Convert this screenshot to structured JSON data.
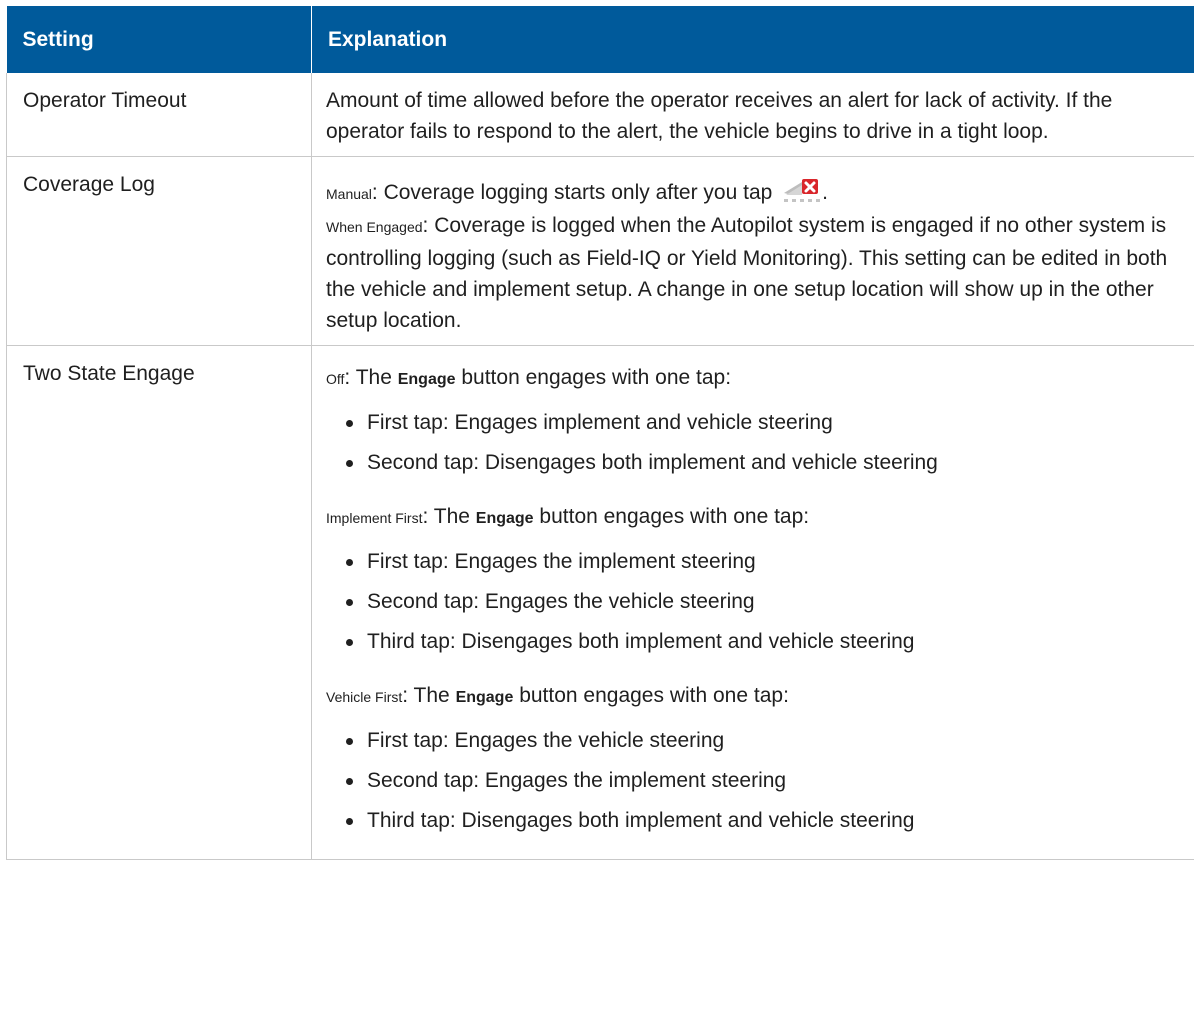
{
  "header": {
    "col_setting": "Setting",
    "col_explanation": "Explanation"
  },
  "rows": [
    {
      "setting": "Operator Timeout",
      "explanation": "Amount of time allowed before the operator receives an alert for lack of activity. If the operator fails to respond to the alert, the vehicle begins to drive in a tight loop."
    },
    {
      "setting": "Coverage Log",
      "manual_term": "Manual",
      "manual_text": ": Coverage logging starts only after you tap ",
      "manual_icon": "coverage-log-icon",
      "manual_end": ".",
      "engaged_term": "When Engaged",
      "engaged_text": ": Coverage is logged when the Autopilot system is engaged if no other system is controlling logging (such as Field-IQ or Yield Monitoring). This setting can be edited in both the vehicle and implement setup. A change in one setup location will show up in the other setup location."
    },
    {
      "setting": "Two State Engage",
      "options": [
        {
          "term": "Off",
          "pre": ": The ",
          "button": "Engage",
          "post": " button engages with one tap:",
          "bullets": [
            "First tap: Engages implement and vehicle steering",
            "Second tap: Disengages both implement and vehicle steering"
          ]
        },
        {
          "term": "Implement First",
          "pre": ": The ",
          "button": "Engage",
          "post": " button engages with one tap:",
          "bullets": [
            "First tap: Engages the implement steering",
            "Second tap: Engages the vehicle steering",
            "Third tap: Disengages both implement and vehicle steering"
          ]
        },
        {
          "term": "Vehicle First",
          "pre": ": The ",
          "button": "Engage",
          "post": " button engages with one tap:",
          "bullets": [
            "First tap: Engages the vehicle steering",
            "Second tap: Engages the implement steering",
            "Third tap: Disengages both implement and vehicle steering"
          ]
        }
      ]
    }
  ],
  "colors": {
    "header_bg": "#005a9b",
    "header_text": "#ffffff",
    "border": "#c9c9c9",
    "icon_red": "#d9262b"
  }
}
